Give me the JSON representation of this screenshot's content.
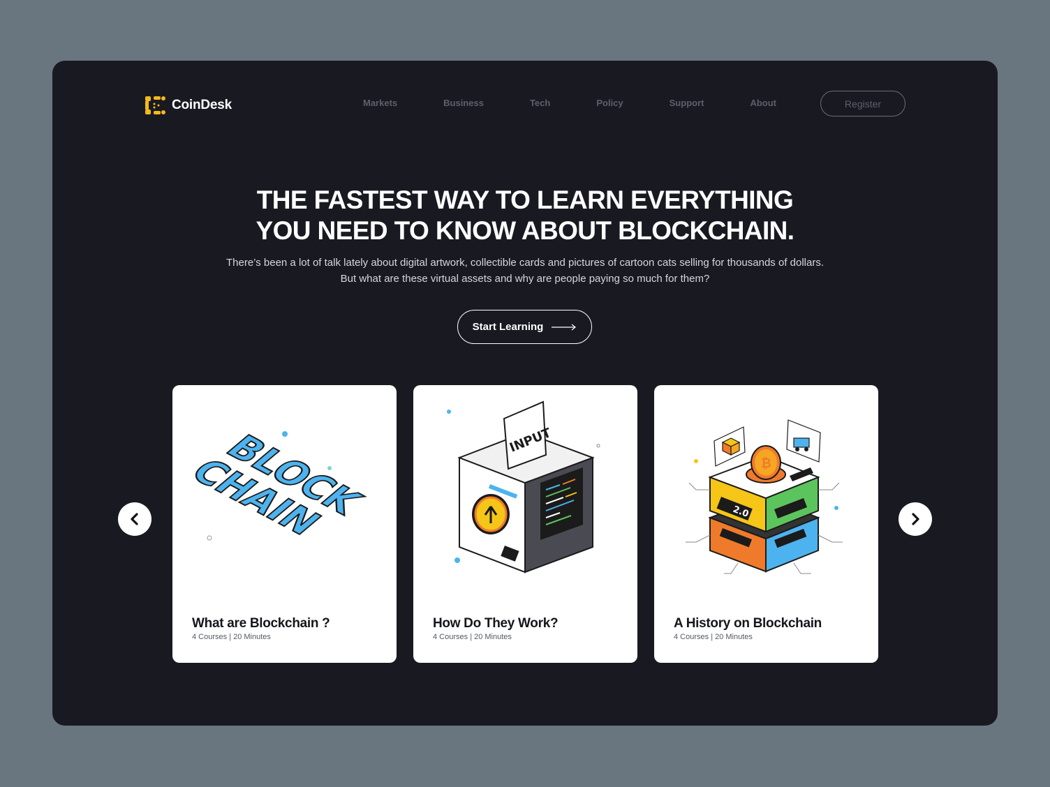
{
  "brand": {
    "name": "CoinDesk",
    "icon": "coindesk-logo-icon",
    "accent": "#f5b91a"
  },
  "nav": {
    "items": [
      "Markets",
      "Business",
      "Tech",
      "Policy",
      "Support",
      "About"
    ]
  },
  "header": {
    "register_label": "Register"
  },
  "hero": {
    "title_line1": "THE FASTEST WAY TO LEARN EVERYTHING",
    "title_line2": "YOU NEED TO KNOW ABOUT BLOCKCHAIN.",
    "subtitle_line1": "There’s been a lot of talk lately about digital artwork, collectible cards and pictures of cartoon cats selling for thousands of dollars.",
    "subtitle_line2": "But what are these virtual assets and why are people paying so much for them?",
    "cta_label": "Start Learning",
    "cta_icon": "long-arrow-right-icon"
  },
  "cards": [
    {
      "title": "What are Blockchain ?",
      "meta": "4 Courses | 20 Minutes",
      "illustration_text": [
        "BLOCK",
        "CHAIN"
      ],
      "icon": "blockchain-3d-text-illustration"
    },
    {
      "title": "How Do They Work?",
      "meta": "4 Courses | 20 Minutes",
      "illustration_text": [
        "INPUT"
      ],
      "icon": "input-machine-illustration"
    },
    {
      "title": "A History on Blockchain",
      "meta": "4 Courses | 20 Minutes",
      "illustration_text": [
        "2.0"
      ],
      "icon": "bitcoin-stack-illustration"
    }
  ],
  "carousel": {
    "prev_icon": "chevron-left-icon",
    "next_icon": "chevron-right-icon"
  },
  "colors": {
    "page_bg": "#69767f",
    "frame_bg": "#191a21",
    "card_bg": "#ffffff",
    "blue": "#4db3ee",
    "yellow": "#f5c518",
    "green": "#5cc45c",
    "orange": "#f07a2b"
  }
}
